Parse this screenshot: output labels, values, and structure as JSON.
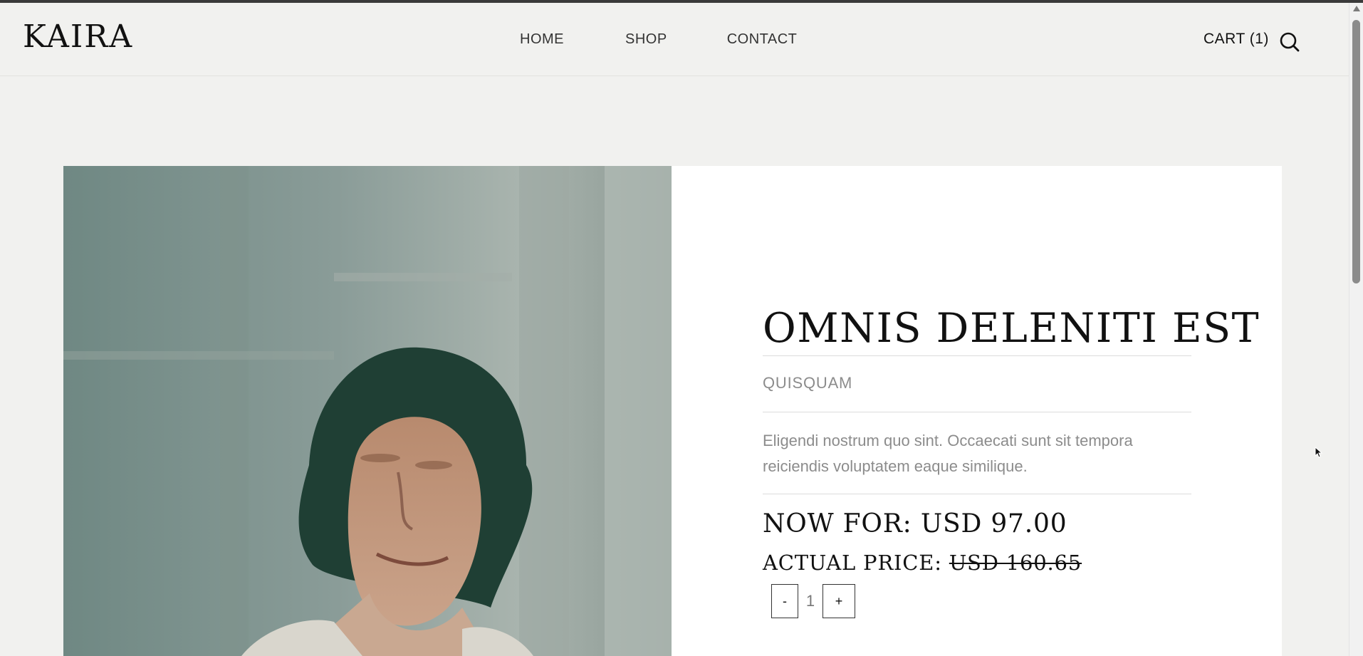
{
  "header": {
    "logo": "KAIRA",
    "nav": [
      {
        "label": "HOME"
      },
      {
        "label": "SHOP"
      },
      {
        "label": "CONTACT"
      }
    ],
    "cart_label": "CART (1)",
    "search_icon": "search-icon"
  },
  "product": {
    "title": "OMNIS DELENITI EST",
    "category": "QUISQUAM",
    "description": "Eligendi nostrum quo sint. Occaecati sunt sit tempora reiciendis voluptatem eaque similique.",
    "now_label": "NOW FOR:",
    "now_price": "USD 97.00",
    "actual_label": "ACTUAL PRICE:",
    "actual_price": "USD 160.65",
    "quantity": {
      "minus_label": "-",
      "value": "1",
      "plus_label": "+"
    }
  },
  "image": {
    "subject": "product-photo"
  },
  "colors": {
    "background": "#f1f1ef",
    "panel": "#ffffff",
    "text": "#111111",
    "muted": "#8c8c8c"
  }
}
